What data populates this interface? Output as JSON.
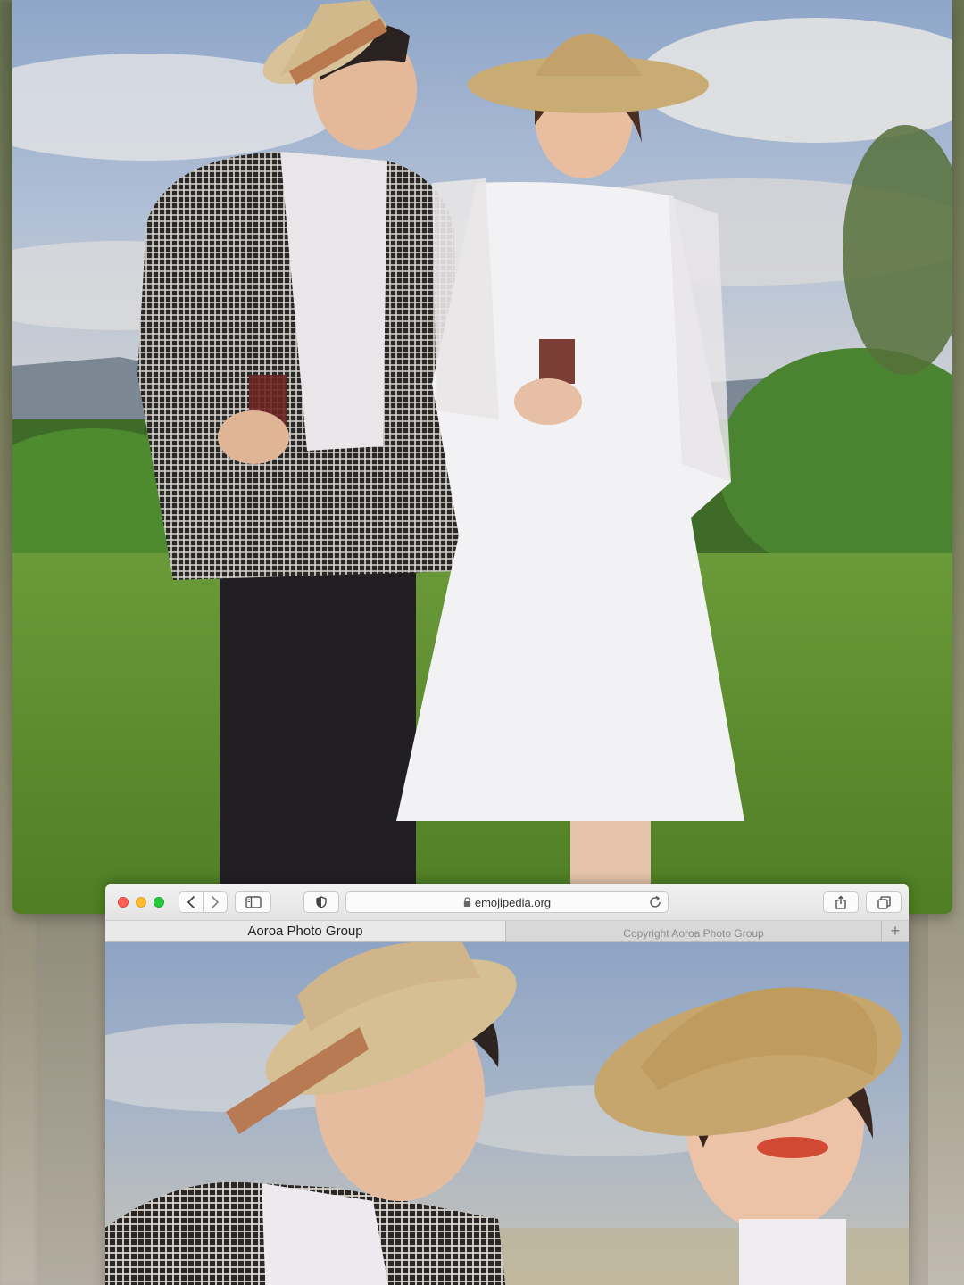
{
  "browser": {
    "address": "emojipedia.org",
    "tabs": [
      {
        "label": "Aoroa Photo Group",
        "active": true
      },
      {
        "label": "Copyright Aoroa Photo Group",
        "active": false
      }
    ],
    "new_tab_label": "+"
  },
  "icons": {
    "back": "chevron-left-icon",
    "forward": "chevron-right-icon",
    "sidebar": "sidebar-icon",
    "privacy": "shield-icon",
    "lock": "lock-icon",
    "reload": "reload-icon",
    "share": "share-icon",
    "tabs": "tabs-overview-icon"
  },
  "colors": {
    "close": "#fe5f57",
    "minimize": "#febc2e",
    "zoom": "#28c840"
  }
}
